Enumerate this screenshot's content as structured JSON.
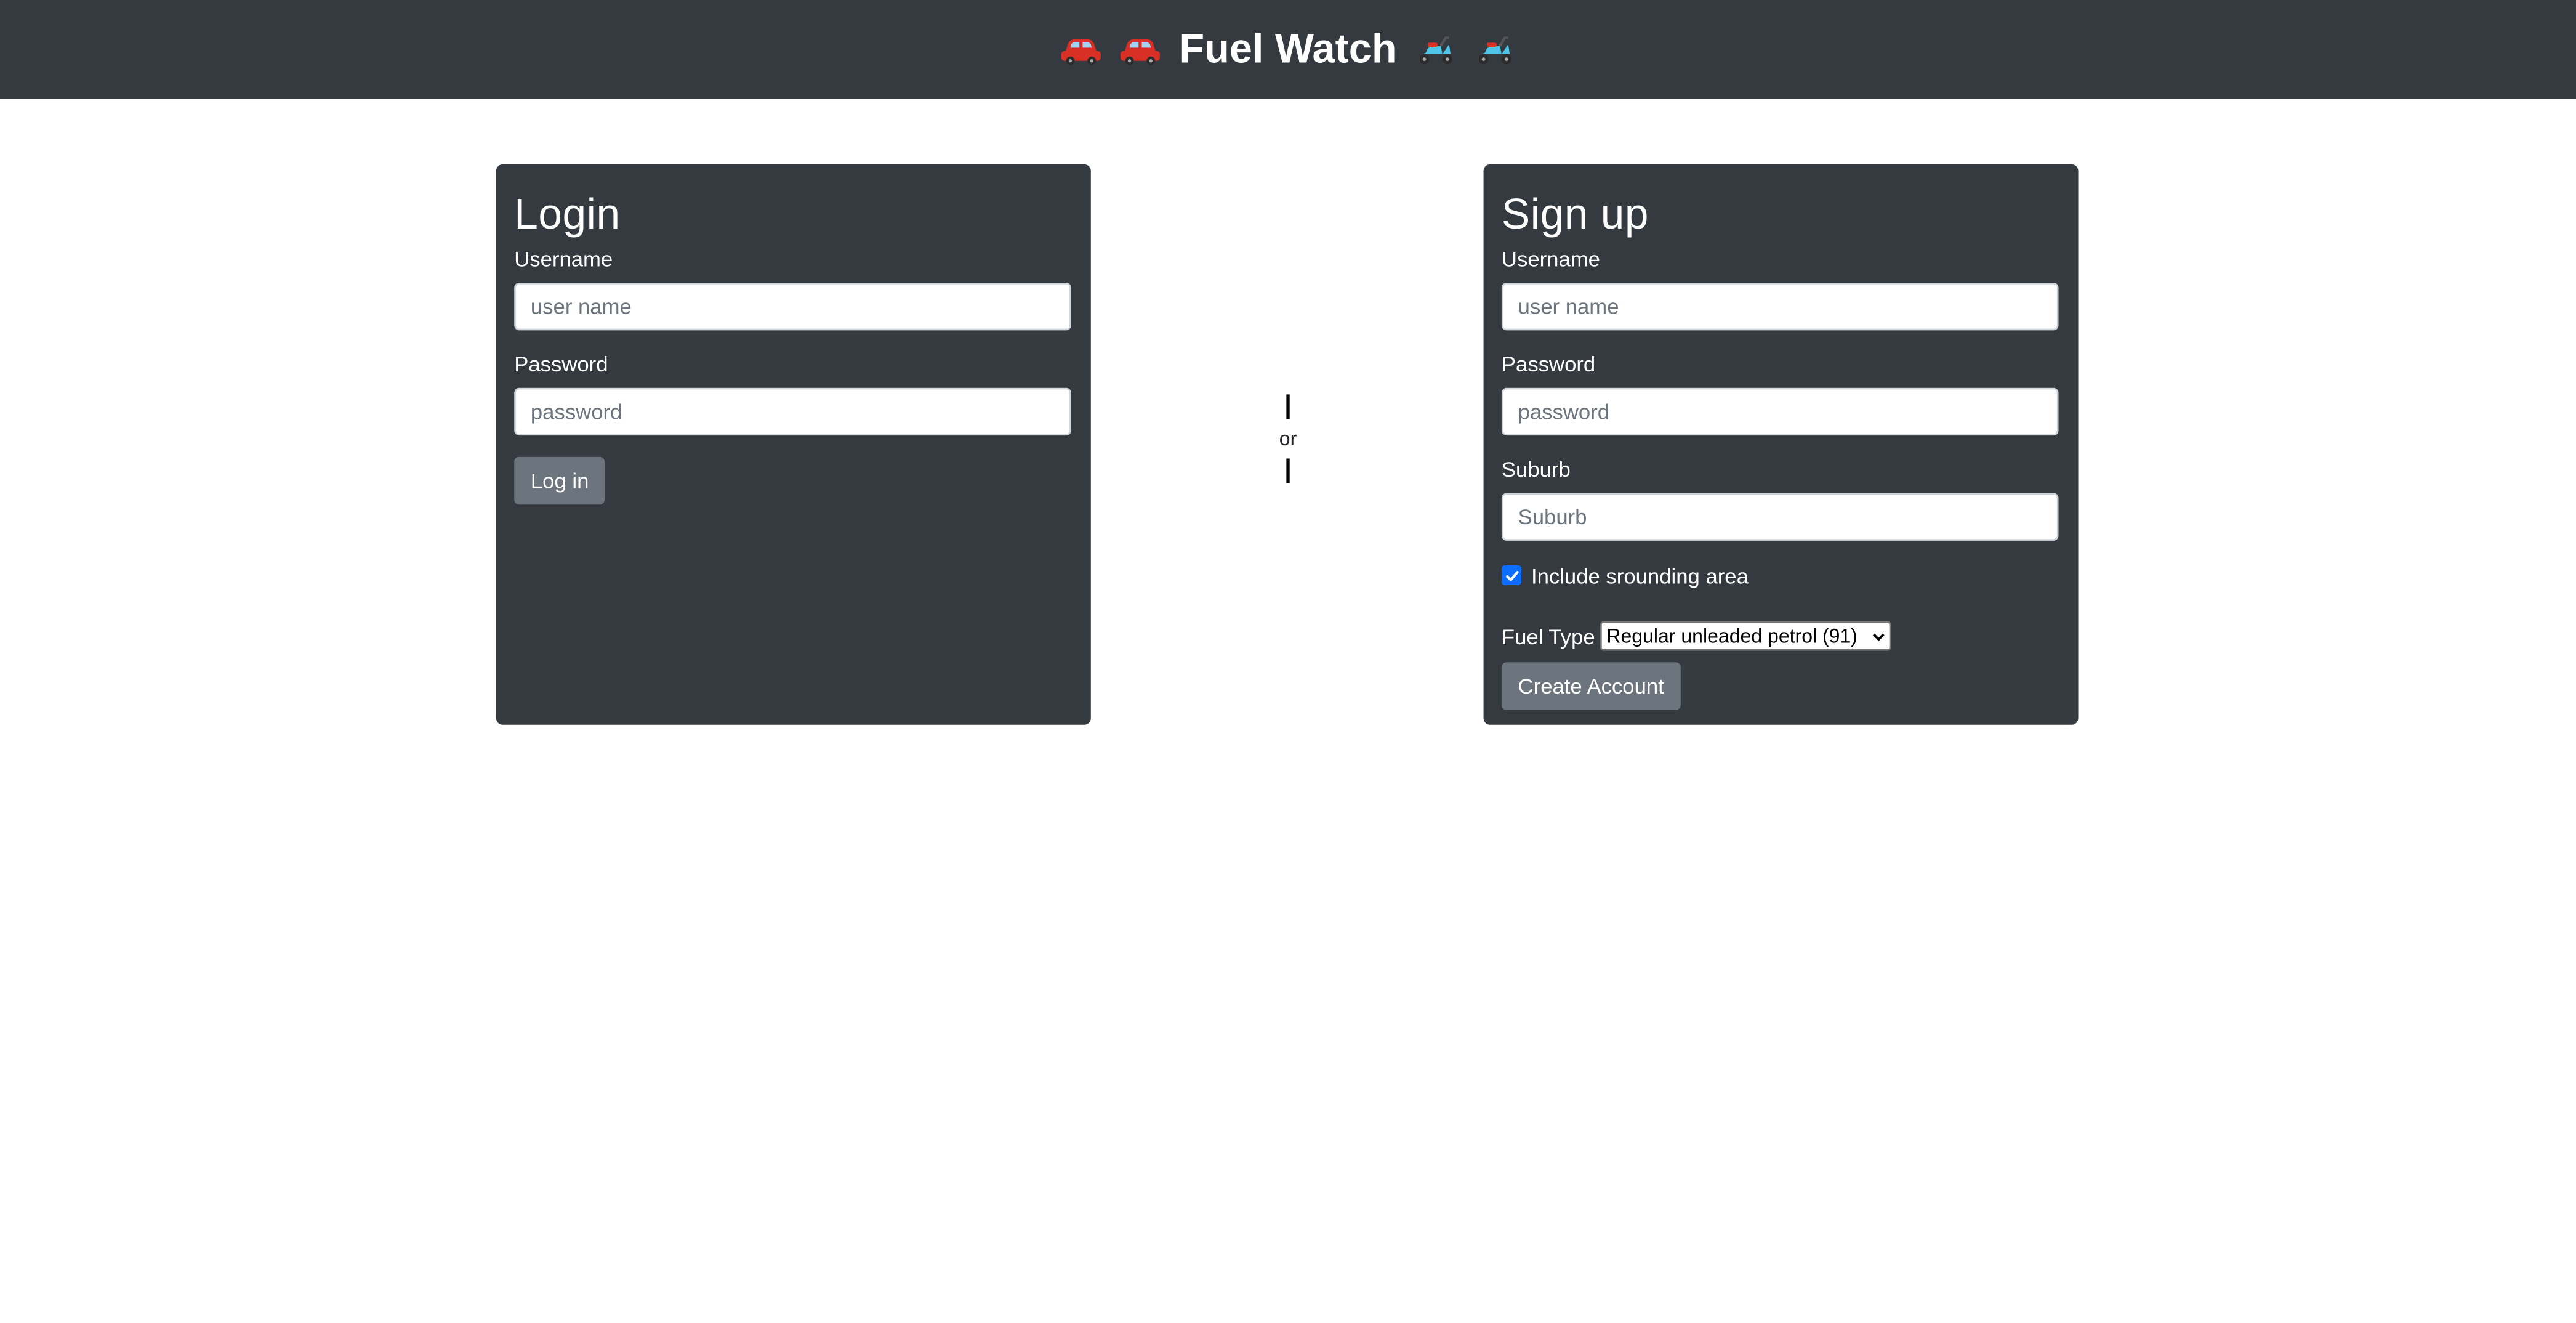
{
  "header": {
    "title": "Fuel Watch",
    "left_icons": [
      "car-icon",
      "car-icon"
    ],
    "right_icons": [
      "scooter-icon",
      "scooter-icon"
    ],
    "background": "#343a40"
  },
  "login": {
    "heading": "Login",
    "username_label": "Username",
    "username_placeholder": "user name",
    "password_label": "Password",
    "password_placeholder": "password",
    "button_label": "Log in"
  },
  "divider": {
    "text": "or"
  },
  "signup": {
    "heading": "Sign up",
    "username_label": "Username",
    "username_placeholder": "user name",
    "password_label": "Password",
    "password_placeholder": "password",
    "suburb_label": "Suburb",
    "suburb_placeholder": "Suburb",
    "include_surrounding_label": "Include srounding area",
    "include_surrounding_checked": true,
    "fuel_type_label": "Fuel Type",
    "fuel_type_selected": "Regular unleaded petrol (91)",
    "button_label": "Create Account"
  },
  "colors": {
    "card_background": "#343a40",
    "button_background": "#6c757d",
    "checkbox_accent": "#0d6efd",
    "car_body": "#d93025",
    "scooter_body": "#4fc3e8"
  }
}
